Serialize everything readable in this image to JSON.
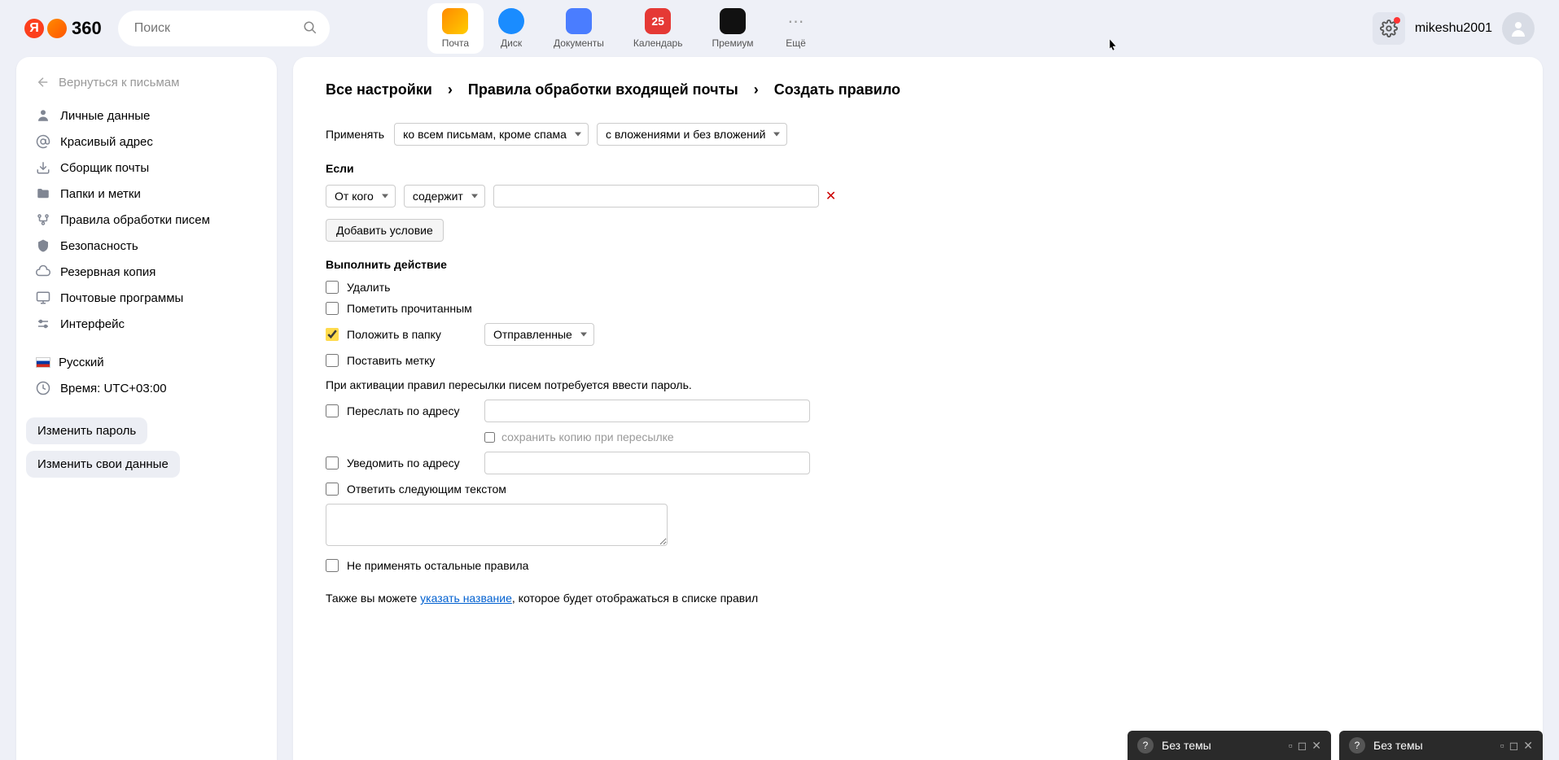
{
  "header": {
    "logo_text": "360",
    "search_placeholder": "Поиск",
    "apps": [
      {
        "label": "Почта",
        "color": "linear-gradient(135deg,#ff8a00,#ffcc00)"
      },
      {
        "label": "Диск",
        "color": "#1a8cff"
      },
      {
        "label": "Документы",
        "color": "#4a7dff"
      },
      {
        "label": "Календарь",
        "color": "#e53935",
        "badge": "25"
      },
      {
        "label": "Премиум",
        "color": "#111"
      },
      {
        "label": "Ещё",
        "color": "transparent"
      }
    ],
    "username": "mikeshu2001"
  },
  "sidebar": {
    "back": "Вернуться к письмам",
    "items": [
      "Личные данные",
      "Красивый адрес",
      "Сборщик почты",
      "Папки и метки",
      "Правила обработки писем",
      "Безопасность",
      "Резервная копия",
      "Почтовые программы",
      "Интерфейс"
    ],
    "language": "Русский",
    "time": "Время: UTC+03:00",
    "change_password": "Изменить пароль",
    "change_data": "Изменить свои данные"
  },
  "breadcrumb": {
    "a": "Все настройки",
    "b": "Правила обработки входящей почты",
    "c": "Создать правило"
  },
  "form": {
    "apply_label": "Применять",
    "apply_select1": "ко всем письмам, кроме спама",
    "apply_select2": "с вложениями и без вложений",
    "if_title": "Если",
    "cond_field": "От кого",
    "cond_op": "содержит",
    "add_condition": "Добавить условие",
    "action_title": "Выполнить действие",
    "act_delete": "Удалить",
    "act_read": "Пометить прочитанным",
    "act_folder": "Положить в папку",
    "act_folder_value": "Отправленные",
    "act_label": "Поставить метку",
    "forward_note": "При активации правил пересылки писем потребуется ввести пароль.",
    "act_forward": "Переслать по адресу",
    "act_forward_copy": "сохранить копию при пересылке",
    "act_notify": "Уведомить по адресу",
    "act_reply": "Ответить следующим текстом",
    "act_stop": "Не применять остальные правила",
    "footer_a": "Также вы можете ",
    "footer_link": "указать название",
    "footer_b": ", которое будет отображаться в списке правил"
  },
  "mini": {
    "title": "Без темы"
  }
}
